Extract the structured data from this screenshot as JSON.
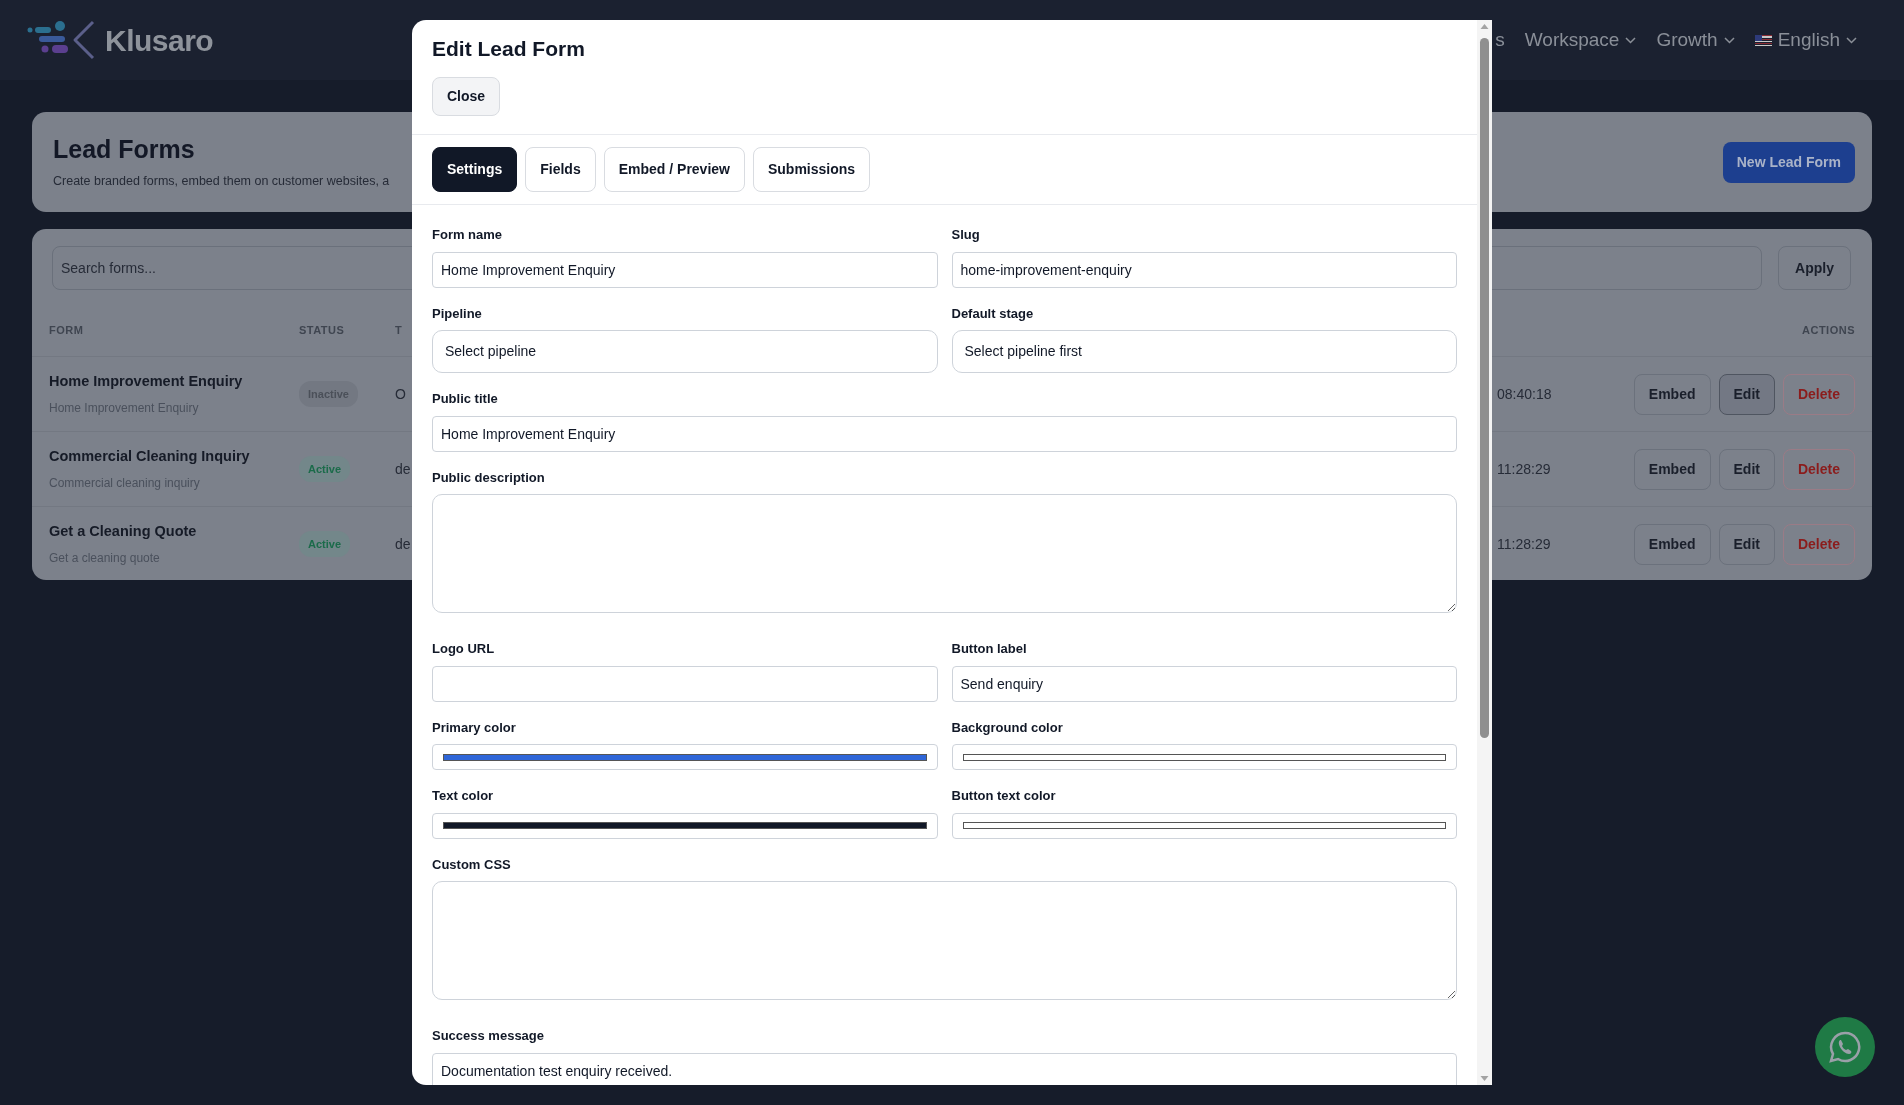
{
  "navbar": {
    "brand": "Klusaro",
    "menus": [
      {
        "label": "s",
        "kind": "link"
      },
      {
        "label": "Workspace",
        "kind": "menu"
      },
      {
        "label": "Growth",
        "kind": "menu"
      },
      {
        "label": "English",
        "kind": "language"
      }
    ]
  },
  "page_header": {
    "title": "Lead Forms",
    "subtitle": "Create branded forms, embed them on customer websites, a",
    "button": "New Lead Form"
  },
  "filter": {
    "placeholder": "Search forms...",
    "button": "Apply"
  },
  "table": {
    "columns": [
      "FORM",
      "STATUS",
      "T",
      "",
      "ACTIONS"
    ],
    "rows": [
      {
        "name": "Home Improvement Enquiry",
        "subtitle": "Home Improvement Enquiry",
        "status": "Inactive",
        "active": false,
        "column_3": "O",
        "column_4": "08:40:18",
        "actions": [
          {
            "label": "Embed",
            "kind": "default",
            "focused": false
          },
          {
            "label": "Edit",
            "kind": "default",
            "focused": true
          },
          {
            "label": "Delete",
            "kind": "danger",
            "focused": false
          }
        ]
      },
      {
        "name": "Commercial Cleaning Inquiry",
        "subtitle": "Commercial cleaning inquiry",
        "status": "Active",
        "active": true,
        "column_3": "de",
        "column_4": "11:28:29",
        "actions": [
          {
            "label": "Embed",
            "kind": "default",
            "focused": false
          },
          {
            "label": "Edit",
            "kind": "default",
            "focused": false
          },
          {
            "label": "Delete",
            "kind": "danger",
            "focused": false
          }
        ]
      },
      {
        "name": "Get a Cleaning Quote",
        "subtitle": "Get a cleaning quote",
        "status": "Active",
        "active": true,
        "column_3": "de",
        "column_4": "11:28:29",
        "actions": [
          {
            "label": "Embed",
            "kind": "default",
            "focused": false
          },
          {
            "label": "Edit",
            "kind": "default",
            "focused": false
          },
          {
            "label": "Delete",
            "kind": "danger",
            "focused": false
          }
        ]
      }
    ]
  },
  "modal": {
    "title": "Edit Lead Form",
    "close": "Close",
    "tabs": [
      {
        "label": "Settings",
        "selected": true
      },
      {
        "label": "Fields",
        "selected": false
      },
      {
        "label": "Embed / Preview",
        "selected": false
      },
      {
        "label": "Submissions",
        "selected": false
      }
    ],
    "rows": [
      {
        "fields": [
          {
            "label": "Form name",
            "kind": "text",
            "value": "Home Improvement Enquiry"
          },
          {
            "label": "Slug",
            "kind": "text",
            "value": "home-improvement-enquiry"
          }
        ]
      },
      {
        "fields": [
          {
            "label": "Pipeline",
            "kind": "select",
            "value": "Select pipeline"
          },
          {
            "label": "Default stage",
            "kind": "select",
            "value": "Select pipeline first"
          }
        ]
      },
      {
        "fields": [
          {
            "label": "Public title",
            "kind": "text",
            "value": "Home Improvement Enquiry"
          }
        ]
      },
      {
        "fields": [
          {
            "label": "Public description",
            "kind": "textarea"
          }
        ]
      },
      {
        "fields": [
          {
            "label": "Logo URL",
            "kind": "text"
          },
          {
            "label": "Button label",
            "kind": "text",
            "value": "Send enquiry"
          }
        ]
      },
      {
        "fields": [
          {
            "label": "Primary color",
            "kind": "color",
            "color": "#2f66d8"
          },
          {
            "label": "Background color",
            "kind": "color",
            "color": "#ffffff"
          }
        ]
      },
      {
        "fields": [
          {
            "label": "Text color",
            "kind": "color",
            "color": "#111827"
          },
          {
            "label": "Button text color",
            "kind": "color",
            "color": "#ffffff"
          }
        ]
      },
      {
        "fields": [
          {
            "label": "Custom CSS",
            "kind": "textarea"
          }
        ]
      },
      {
        "fields": [
          {
            "label": "Success message",
            "kind": "text",
            "value": "Documentation test enquiry received."
          }
        ]
      }
    ]
  }
}
